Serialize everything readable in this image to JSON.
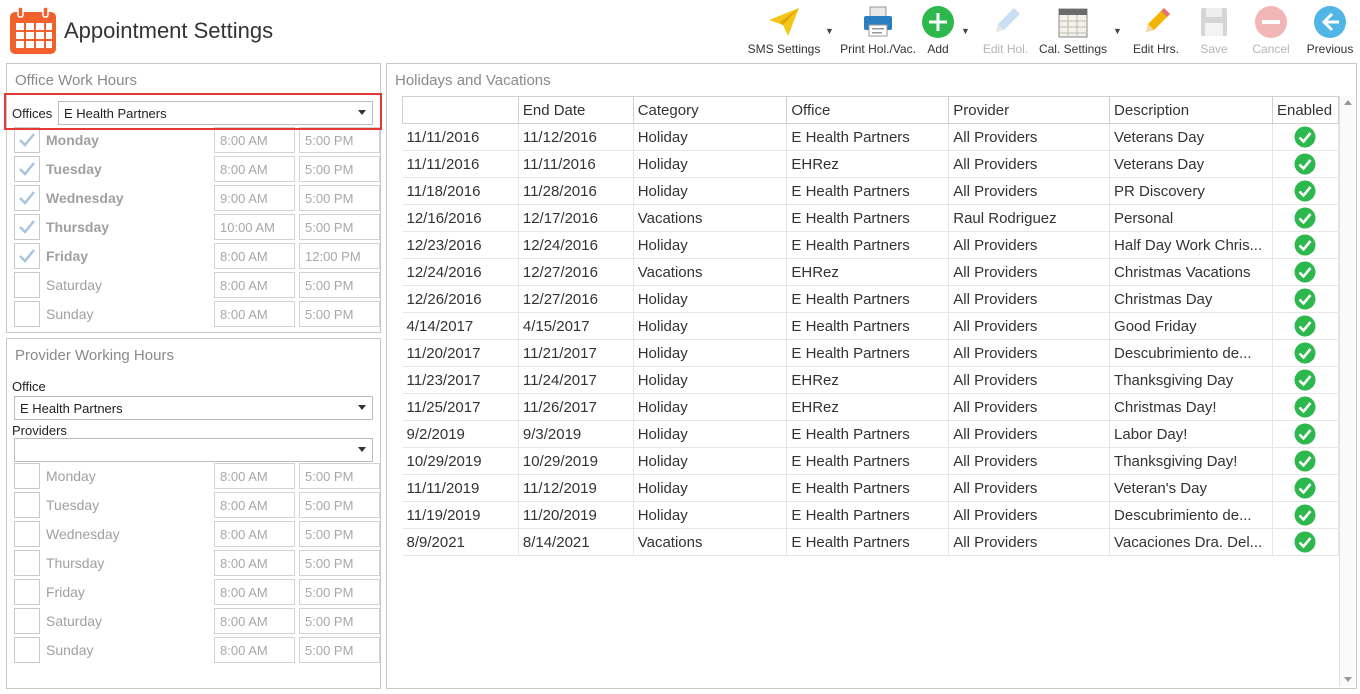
{
  "app": {
    "title": "Appointment Settings"
  },
  "toolbar": {
    "sms": "SMS Settings",
    "print": "Print Hol./Vac.",
    "add": "Add",
    "edit_hol": "Edit Hol.",
    "cal_settings": "Cal. Settings",
    "edit_hrs": "Edit Hrs.",
    "save": "Save",
    "cancel": "Cancel",
    "previous": "Previous"
  },
  "office_hours": {
    "title": "Office Work Hours",
    "offices_label": "Offices",
    "offices_value": "E Health Partners",
    "days": [
      {
        "name": "Monday",
        "checked": true,
        "start": "8:00 AM",
        "end": "5:00 PM"
      },
      {
        "name": "Tuesday",
        "checked": true,
        "start": "8:00 AM",
        "end": "5:00 PM"
      },
      {
        "name": "Wednesday",
        "checked": true,
        "start": "9:00 AM",
        "end": "5:00 PM"
      },
      {
        "name": "Thursday",
        "checked": true,
        "start": "10:00 AM",
        "end": "5:00 PM"
      },
      {
        "name": "Friday",
        "checked": true,
        "start": "8:00 AM",
        "end": "12:00 PM"
      },
      {
        "name": "Saturday",
        "checked": false,
        "start": "8:00 AM",
        "end": "5:00 PM"
      },
      {
        "name": "Sunday",
        "checked": false,
        "start": "8:00 AM",
        "end": "5:00 PM"
      }
    ]
  },
  "provider_hours": {
    "title": "Provider Working Hours",
    "office_label": "Office",
    "office_value": "E Health Partners",
    "providers_label": "Providers",
    "providers_value": "",
    "days": [
      {
        "name": "Monday",
        "start": "8:00 AM",
        "end": "5:00 PM"
      },
      {
        "name": "Tuesday",
        "start": "8:00 AM",
        "end": "5:00 PM"
      },
      {
        "name": "Wednesday",
        "start": "8:00 AM",
        "end": "5:00 PM"
      },
      {
        "name": "Thursday",
        "start": "8:00 AM",
        "end": "5:00 PM"
      },
      {
        "name": "Friday",
        "start": "8:00 AM",
        "end": "5:00 PM"
      },
      {
        "name": "Saturday",
        "start": "8:00 AM",
        "end": "5:00 PM"
      },
      {
        "name": "Sunday",
        "start": "8:00 AM",
        "end": "5:00 PM"
      }
    ]
  },
  "holidays": {
    "title": "Holidays and Vacations",
    "columns": [
      "",
      "End Date",
      "Category",
      "Office",
      "Provider",
      "Description",
      "Enabled"
    ],
    "rows": [
      [
        "11/11/2016",
        "11/12/2016",
        "Holiday",
        "E Health Partners",
        "All Providers",
        "Veterans Day",
        true
      ],
      [
        "11/11/2016",
        "11/11/2016",
        "Holiday",
        "EHRez",
        "All Providers",
        "Veterans Day",
        true
      ],
      [
        "11/18/2016",
        "11/28/2016",
        "Holiday",
        "E Health Partners",
        "All Providers",
        "PR Discovery",
        true
      ],
      [
        "12/16/2016",
        "12/17/2016",
        "Vacations",
        "E Health Partners",
        "Raul Rodriguez",
        "Personal",
        true
      ],
      [
        "12/23/2016",
        "12/24/2016",
        "Holiday",
        "E Health Partners",
        "All Providers",
        "Half Day Work Chris...",
        true
      ],
      [
        "12/24/2016",
        "12/27/2016",
        "Vacations",
        "EHRez",
        "All Providers",
        "Christmas Vacations",
        true
      ],
      [
        "12/26/2016",
        "12/27/2016",
        "Holiday",
        "E Health Partners",
        "All Providers",
        "Christmas Day",
        true
      ],
      [
        "4/14/2017",
        "4/15/2017",
        "Holiday",
        "E Health Partners",
        "All Providers",
        "Good Friday",
        true
      ],
      [
        "11/20/2017",
        "11/21/2017",
        "Holiday",
        "E Health Partners",
        "All Providers",
        "Descubrimiento de...",
        true
      ],
      [
        "11/23/2017",
        "11/24/2017",
        "Holiday",
        "EHRez",
        "All Providers",
        "Thanksgiving Day",
        true
      ],
      [
        "11/25/2017",
        "11/26/2017",
        "Holiday",
        "EHRez",
        "All Providers",
        "Christmas Day!",
        true
      ],
      [
        "9/2/2019",
        "9/3/2019",
        "Holiday",
        "E Health Partners",
        "All Providers",
        "Labor Day!",
        true
      ],
      [
        "10/29/2019",
        "10/29/2019",
        "Holiday",
        "E Health Partners",
        "All Providers",
        "Thanksgiving Day!",
        true
      ],
      [
        "11/11/2019",
        "11/12/2019",
        "Holiday",
        "E Health Partners",
        "All Providers",
        "Veteran's Day",
        true
      ],
      [
        "11/19/2019",
        "11/20/2019",
        "Holiday",
        "E Health Partners",
        "All Providers",
        "Descubrimiento de...",
        true
      ],
      [
        "8/9/2021",
        "8/14/2021",
        "Vacations",
        "E Health Partners",
        "All Providers",
        "Vacaciones Dra. Del...",
        true
      ]
    ]
  },
  "colors": {
    "accent_orange": "#f2612d",
    "highlight_red": "#e53935",
    "enabled_green": "#2db84d"
  }
}
